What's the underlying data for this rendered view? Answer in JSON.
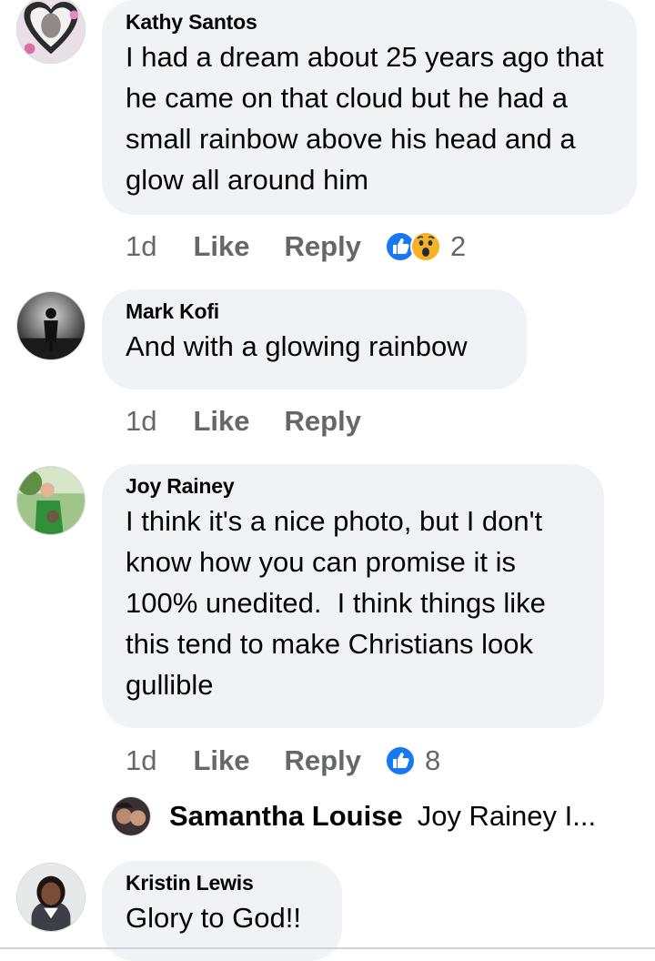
{
  "comments": [
    {
      "author": "Kathy Santos",
      "text": "I had a dream about 25 years ago that he came on that cloud but he had a small rainbow above his head and a glow all around him",
      "time": "1d",
      "like": "Like",
      "reply": "Reply",
      "reactions": [
        "like-icon",
        "wow-icon"
      ],
      "reaction_count": "2"
    },
    {
      "author": "Mark Kofi",
      "text": "And with a glowing rainbow",
      "time": "1d",
      "like": "Like",
      "reply": "Reply"
    },
    {
      "author": "Joy Rainey",
      "text": "I think it's a nice photo, but I don't know how you can promise it is 100% unedited.  I think things like this tend to make Christians look gullible",
      "time": "1d",
      "like": "Like",
      "reply": "Reply",
      "reactions": [
        "like-icon"
      ],
      "reaction_count": "8"
    },
    {
      "author": "Kristin Lewis",
      "text": "Glory to God!!"
    }
  ],
  "reply_preview": {
    "author": "Samantha Louise",
    "text": "Joy Rainey  I..."
  },
  "colors": {
    "bubble": "#f0f2f5",
    "secondary_text": "#65676b",
    "like_blue": "#1877f2",
    "wow_yellow": "#f7b125"
  }
}
